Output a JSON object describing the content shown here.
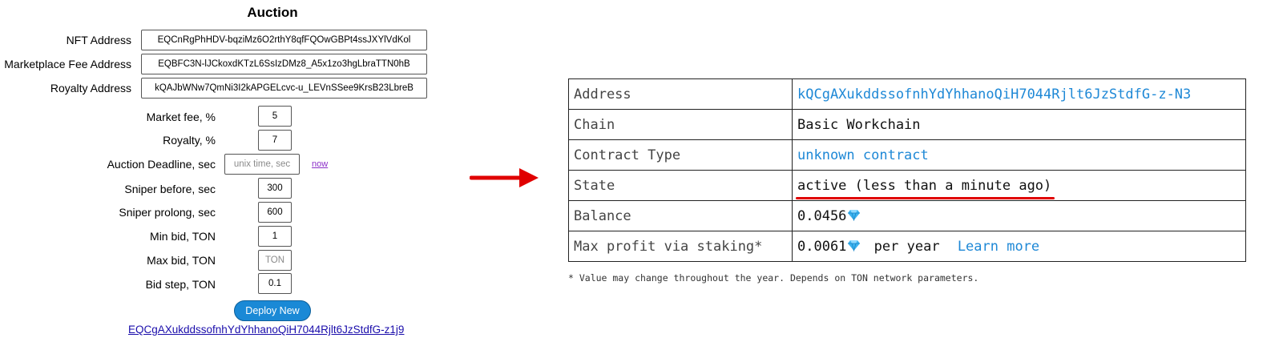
{
  "form": {
    "title": "Auction",
    "nft_address_label": "NFT Address",
    "nft_address_value": "EQCnRgPhHDV-bqziMz6O2rthY8qfFQOwGBPt4ssJXYlVdKol",
    "marketplace_fee_label": "Marketplace Fee Address",
    "marketplace_fee_value": "EQBFC3N-lJCkoxdKTzL6SsIzDMz8_A5x1zo3hgLbraTTN0hB",
    "royalty_address_label": "Royalty Address",
    "royalty_address_value": "kQAJbWNw7QmNi3I2kAPGELcvc-u_LEVnSSee9KrsB23LbreB",
    "market_fee_label": "Market fee, %",
    "market_fee_value": "5",
    "royalty_label": "Royalty, %",
    "royalty_value": "7",
    "deadline_label": "Auction Deadline, sec",
    "deadline_placeholder": "unix time, sec",
    "now_link": "now",
    "sniper_before_label": "Sniper before, sec",
    "sniper_before_value": "300",
    "sniper_prolong_label": "Sniper prolong, sec",
    "sniper_prolong_value": "600",
    "min_bid_label": "Min bid, TON",
    "min_bid_value": "1",
    "max_bid_label": "Max bid, TON",
    "max_bid_placeholder": "TON",
    "bid_step_label": "Bid step, TON",
    "bid_step_value": "0.1",
    "deploy_button": "Deploy New",
    "result_link": "EQCgAXukddssofnhYdYhhanoQiH7044Rjlt6JzStdfG-z1j9"
  },
  "arrow_icon": "arrow-right-icon",
  "arrow_color": "#e00000",
  "info": {
    "rows": [
      {
        "key": "Address",
        "value": "kQCgAXukddssofnhYdYhhanoQiH7044Rjlt6JzStdfG-z-N3"
      },
      {
        "key": "Chain",
        "value": "Basic Workchain"
      },
      {
        "key": "Contract Type",
        "value": "unknown contract"
      },
      {
        "key": "State",
        "value": "active (less than a minute ago)"
      },
      {
        "key": "Balance",
        "value": "0.0456"
      },
      {
        "key": "Max profit via staking*",
        "value": "0.0061",
        "suffix": "per year",
        "link": "Learn more"
      }
    ],
    "gem_icon": "diamond-icon",
    "footnote": "* Value may change throughout the year. Depends on TON network parameters."
  }
}
